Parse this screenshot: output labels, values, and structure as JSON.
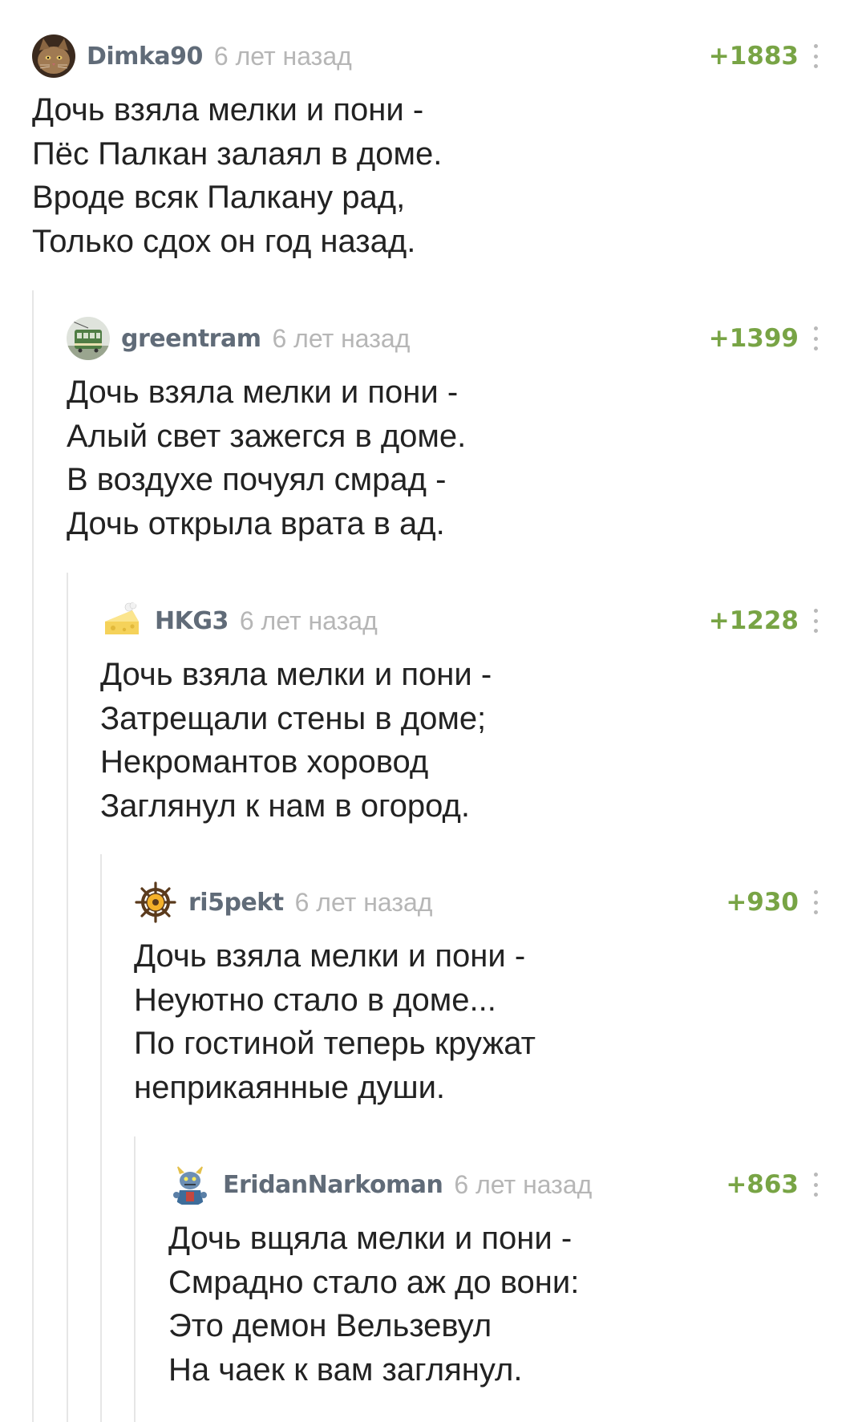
{
  "comments": [
    {
      "username": "Dimka90",
      "time": "6 лет назад",
      "rating": "+1883",
      "avatar": "cat-avatar",
      "lines": [
        "Дочь взяла мелки и пони -",
        "Пёс Палкан залаял в доме.",
        "Вроде всяк Палкану рад,",
        "Только сдох он год назад."
      ]
    },
    {
      "username": "greentram",
      "time": "6 лет назад",
      "rating": "+1399",
      "avatar": "tram-avatar",
      "lines": [
        "Дочь взяла мелки и пони -",
        "Алый свет зажегся в доме.",
        "В воздухе почуял смрад -",
        "Дочь открыла врата в ад."
      ]
    },
    {
      "username": "HKG3",
      "time": "6 лет назад",
      "rating": "+1228",
      "avatar": "cheese-avatar",
      "lines": [
        "Дочь взяла мелки и пони -",
        "Затрещали стены в доме;",
        "Некромантов хоровод",
        "Заглянул к нам в огород."
      ]
    },
    {
      "username": "ri5pekt",
      "time": "6 лет назад",
      "rating": "+930",
      "avatar": "ship-wheel-avatar",
      "lines": [
        "Дочь взяла мелки и пони -",
        "Неуютно стало в доме...",
        "По гостиной теперь кружат",
        "неприкаянные души."
      ]
    },
    {
      "username": "EridanNarkoman",
      "time": "6 лет назад",
      "rating": "+863",
      "avatar": "monster-avatar",
      "lines": [
        "Дочь вщяла мелки и пони -",
        "Смрадно стало аж до вони:",
        "Это демон Вельзевул",
        "На чаек к вам заглянул."
      ]
    }
  ],
  "colors": {
    "username": "#606b78",
    "time": "#b6b6b6",
    "rating": "#78a445",
    "text": "#222222",
    "thread_line": "#e6e6e6"
  }
}
